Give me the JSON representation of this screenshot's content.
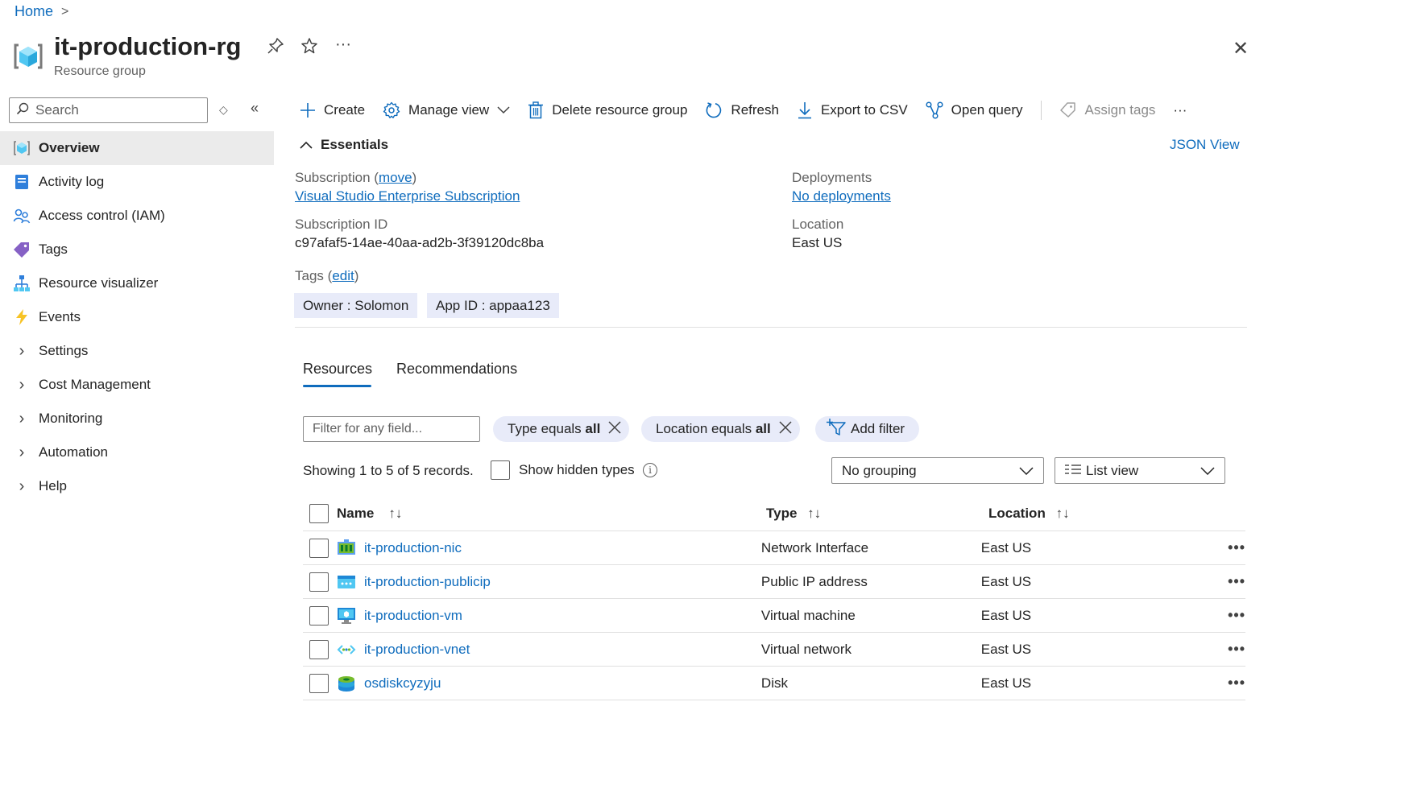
{
  "breadcrumb": {
    "home": "Home",
    "sep": ">"
  },
  "header": {
    "title": "it-production-rg",
    "subtitle": "Resource group",
    "more": "···",
    "close": "✕"
  },
  "sidebar": {
    "search_placeholder": "Search",
    "sort_symbol": "◇",
    "collapse_symbol": "«",
    "items": [
      {
        "label": "Overview",
        "icon": "resource-group-icon",
        "selected": true
      },
      {
        "label": "Activity log",
        "icon": "activity-log-icon"
      },
      {
        "label": "Access control (IAM)",
        "icon": "people-icon"
      },
      {
        "label": "Tags",
        "icon": "tag-icon"
      },
      {
        "label": "Resource visualizer",
        "icon": "hierarchy-icon"
      },
      {
        "label": "Events",
        "icon": "lightning-icon"
      },
      {
        "label": "Settings",
        "expandable": true
      },
      {
        "label": "Cost Management",
        "expandable": true
      },
      {
        "label": "Monitoring",
        "expandable": true
      },
      {
        "label": "Automation",
        "expandable": true
      },
      {
        "label": "Help",
        "expandable": true
      }
    ]
  },
  "toolbar": {
    "create": "Create",
    "manage_view": "Manage view",
    "delete": "Delete resource group",
    "refresh": "Refresh",
    "export": "Export to CSV",
    "open_query": "Open query",
    "assign_tags": "Assign tags",
    "more": "···"
  },
  "essentials": {
    "heading": "Essentials",
    "json_view": "JSON View",
    "subscription_label": "Subscription",
    "move_link": "move",
    "subscription_value": "Visual Studio Enterprise Subscription",
    "subscription_id_label": "Subscription ID",
    "subscription_id_value": "c97afaf5-14ae-40aa-ad2b-3f39120dc8ba",
    "deployments_label": "Deployments",
    "deployments_value": "No deployments",
    "location_label": "Location",
    "location_value": "East US",
    "tags_label": "Tags",
    "edit_link": "edit",
    "tags": [
      "Owner : Solomon",
      "App ID : appaa123"
    ]
  },
  "tabs": {
    "resources": "Resources",
    "recommendations": "Recommendations"
  },
  "filters": {
    "placeholder": "Filter for any field...",
    "type_prefix": "Type equals ",
    "type_value": "all",
    "location_prefix": "Location equals ",
    "location_value": "all",
    "add_filter": "Add filter"
  },
  "records": {
    "showing": "Showing 1 to 5 of 5 records.",
    "show_hidden": "Show hidden types",
    "info_glyph": "i",
    "grouping": "No grouping",
    "view": "List view"
  },
  "table": {
    "headers": {
      "name": "Name",
      "type": "Type",
      "location": "Location"
    },
    "more": "•••",
    "rows": [
      {
        "name": "it-production-nic",
        "type": "Network Interface",
        "location": "East US",
        "icon": "network-interface-icon"
      },
      {
        "name": "it-production-publicip",
        "type": "Public IP address",
        "location": "East US",
        "icon": "public-ip-icon"
      },
      {
        "name": "it-production-vm",
        "type": "Virtual machine",
        "location": "East US",
        "icon": "virtual-machine-icon"
      },
      {
        "name": "it-production-vnet",
        "type": "Virtual network",
        "location": "East US",
        "icon": "virtual-network-icon"
      },
      {
        "name": "osdiskcyzyju",
        "type": "Disk",
        "location": "East US",
        "icon": "disk-icon"
      }
    ]
  },
  "colors": {
    "accent": "#0f6cbd",
    "chip": "#e8ebf9",
    "selected_nav": "#ebebeb"
  }
}
